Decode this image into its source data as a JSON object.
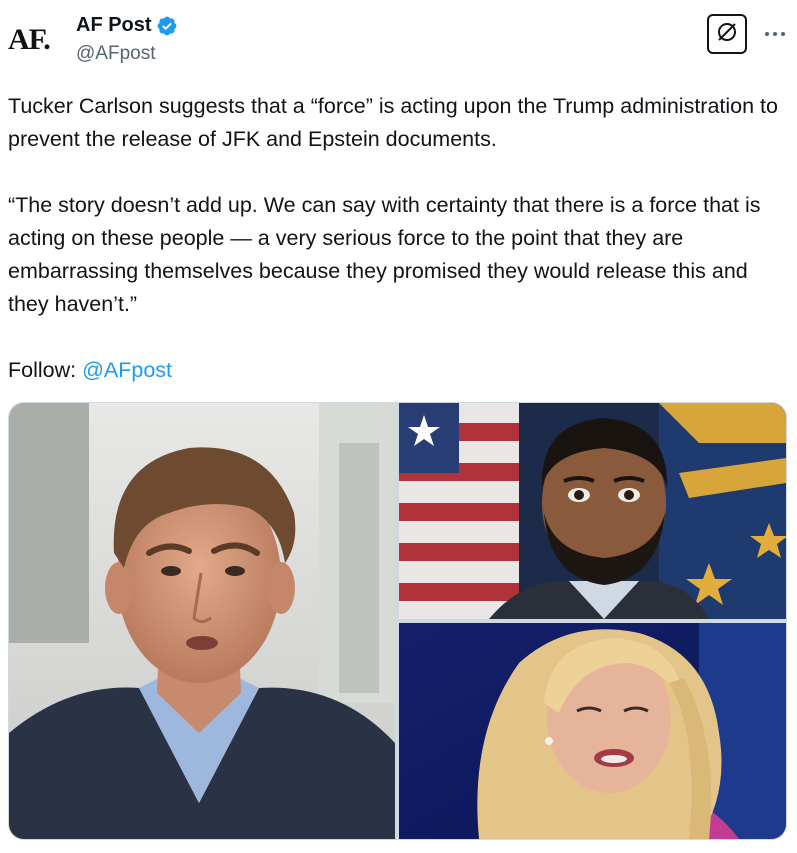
{
  "post": {
    "author": {
      "avatar_text": "AF.",
      "display_name": "AF Post",
      "handle": "@AFpost",
      "verified": true,
      "verified_color": "#1d9bf0"
    },
    "header_actions": {
      "grok_icon": "grok-slash-circle-icon",
      "more_icon": "more-dots-icon"
    },
    "body": {
      "paragraph_1": "Tucker Carlson suggests that a “force” is acting upon the Trump administration to prevent the release of JFK and Epstein documents.",
      "paragraph_2": "“The story doesn’t add up. We can say with certainty that there is a force that is acting on these people — a very serious force to the point that they are embarrassing themselves because they promised they would release this and they haven’t.”",
      "follow_label": "Follow: ",
      "follow_mention": "@AFpost"
    },
    "media": {
      "count": 3,
      "photos": [
        {
          "subject": "man-in-suit-outdoors"
        },
        {
          "subject": "bearded-man-in-front-of-flags"
        },
        {
          "subject": "blonde-woman-speaking"
        }
      ]
    },
    "colors": {
      "text": "#0f1419",
      "secondary_text": "#536471",
      "link": "#1d9bf0",
      "border": "#cfd9de"
    }
  }
}
